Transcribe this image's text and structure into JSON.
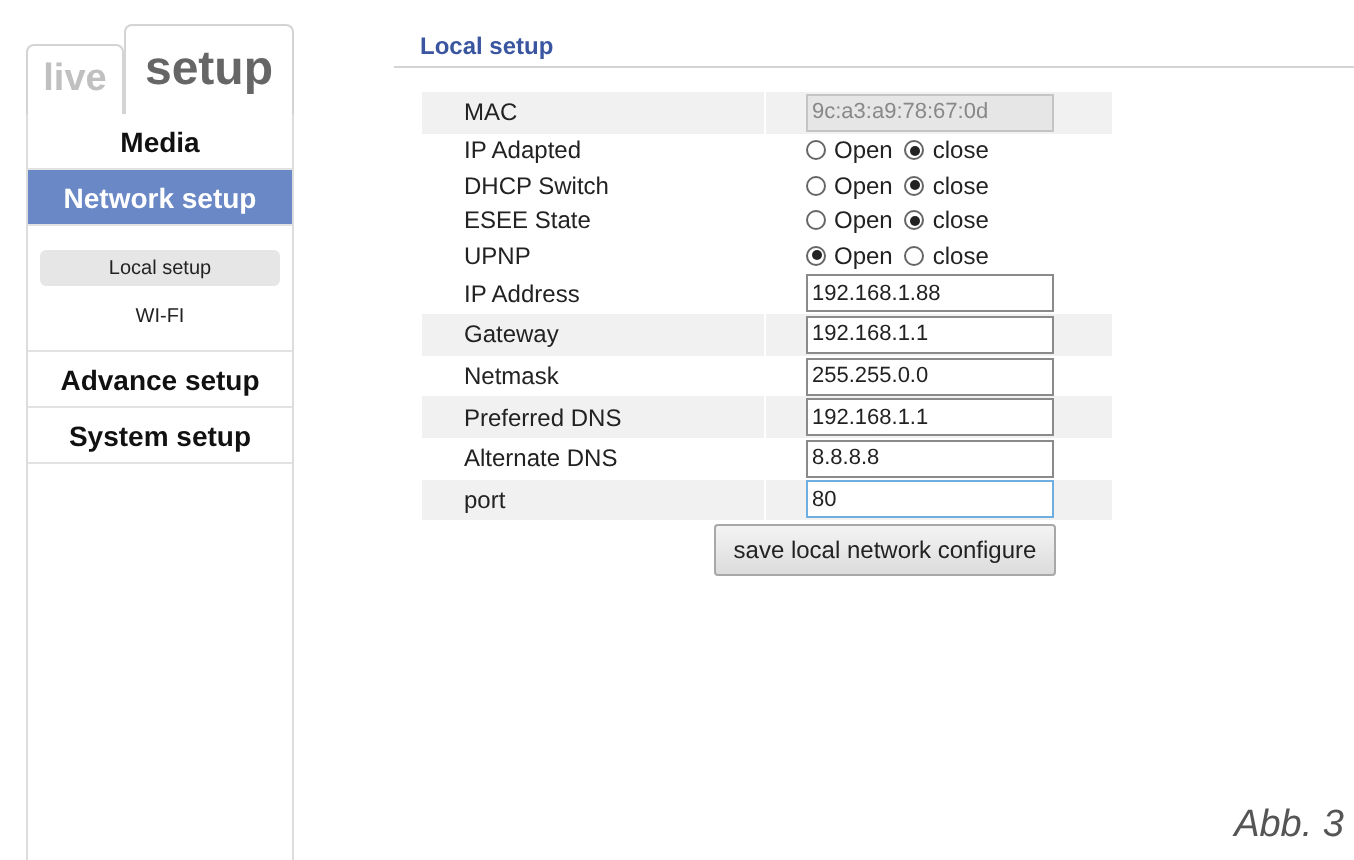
{
  "tabs": [
    {
      "label": "live",
      "selected": false
    },
    {
      "label": "setup",
      "selected": true
    }
  ],
  "menu": [
    {
      "label": "Media",
      "selected": false
    },
    {
      "label": "Network setup",
      "selected": true,
      "children": [
        {
          "label": "Local setup",
          "selected": true
        },
        {
          "label": "WI-FI",
          "selected": false
        }
      ]
    },
    {
      "label": "Advance setup",
      "selected": false
    },
    {
      "label": "System setup",
      "selected": false
    }
  ],
  "section_title": "Local setup",
  "rows": [
    {
      "kind": "readonly",
      "label": "MAC",
      "value": "9c:a3:a9:78:67:0d"
    },
    {
      "kind": "radio",
      "label": "IP Adapted",
      "options": [
        {
          "label": "Open",
          "selected": false
        },
        {
          "label": "close",
          "selected": true
        }
      ]
    },
    {
      "kind": "radio",
      "label": "DHCP Switch",
      "options": [
        {
          "label": "Open",
          "selected": false
        },
        {
          "label": "close",
          "selected": true
        }
      ]
    },
    {
      "kind": "radio",
      "label": "ESEE State",
      "options": [
        {
          "label": "Open",
          "selected": false
        },
        {
          "label": "close",
          "selected": true
        }
      ]
    },
    {
      "kind": "radio",
      "label": "UPNP",
      "options": [
        {
          "label": "Open",
          "selected": true
        },
        {
          "label": "close",
          "selected": false
        }
      ]
    },
    {
      "kind": "input",
      "label": "IP Address",
      "value": "192.168.1.88",
      "focused": false
    },
    {
      "kind": "input",
      "label": "Gateway",
      "value": "192.168.1.1",
      "focused": false
    },
    {
      "kind": "input",
      "label": "Netmask",
      "value": "255.255.0.0",
      "focused": false
    },
    {
      "kind": "input",
      "label": "Preferred DNS",
      "value": "192.168.1.1",
      "focused": false
    },
    {
      "kind": "input",
      "label": "Alternate DNS",
      "value": "8.8.8.8",
      "focused": false
    },
    {
      "kind": "input",
      "label": "port",
      "value": "80",
      "focused": true
    }
  ],
  "save_button": "save local network configure",
  "caption": "Abb. 3"
}
